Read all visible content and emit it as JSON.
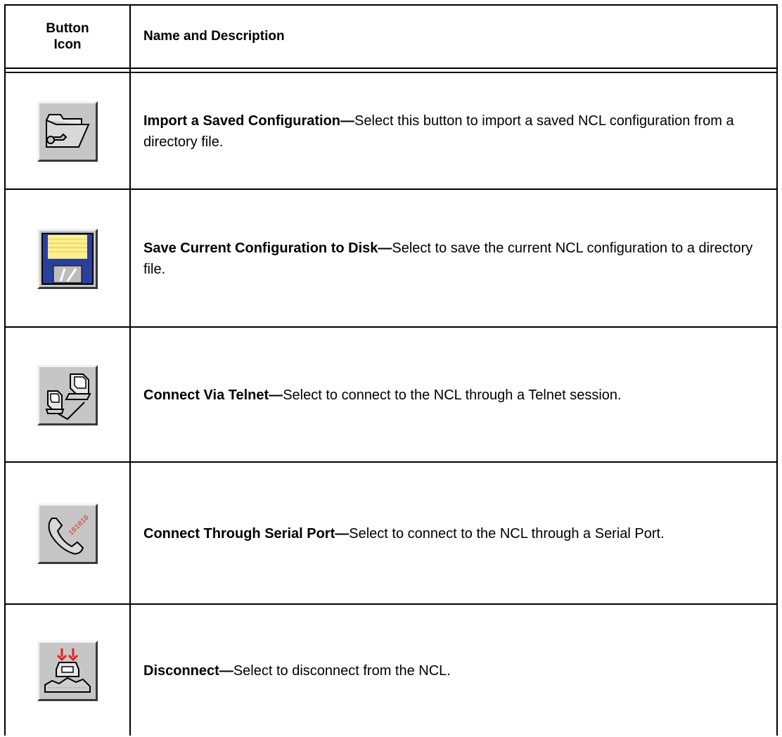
{
  "table": {
    "header": {
      "icon_col": "Button Icon",
      "name_col": "Name and Description"
    },
    "rows": [
      {
        "icon": "folder-wrench-icon",
        "title": "Import a Saved Configuration—",
        "desc": "Select this button to import a saved NCL configuration from a directory file."
      },
      {
        "icon": "floppy-disk-icon",
        "title": "Save Current Configuration to Disk—",
        "desc": "Select to save the current NCL configuration to a directory file."
      },
      {
        "icon": "telnet-computers-icon",
        "title": "Connect Via Telnet—",
        "desc": "Select to connect to the NCL through a Telnet session."
      },
      {
        "icon": "serial-phone-icon",
        "title": "Connect Through Serial Port—",
        "desc": "Select to connect to the NCL through a Serial Port."
      },
      {
        "icon": "disconnect-icon",
        "title": "Disconnect—",
        "desc": "Select to disconnect from the NCL."
      }
    ]
  },
  "colors": {
    "button_face": "#c6c6c6",
    "floppy_blue": "#2b3f9c",
    "floppy_label": "#ffef8a",
    "arrow_red": "#e2231a"
  }
}
